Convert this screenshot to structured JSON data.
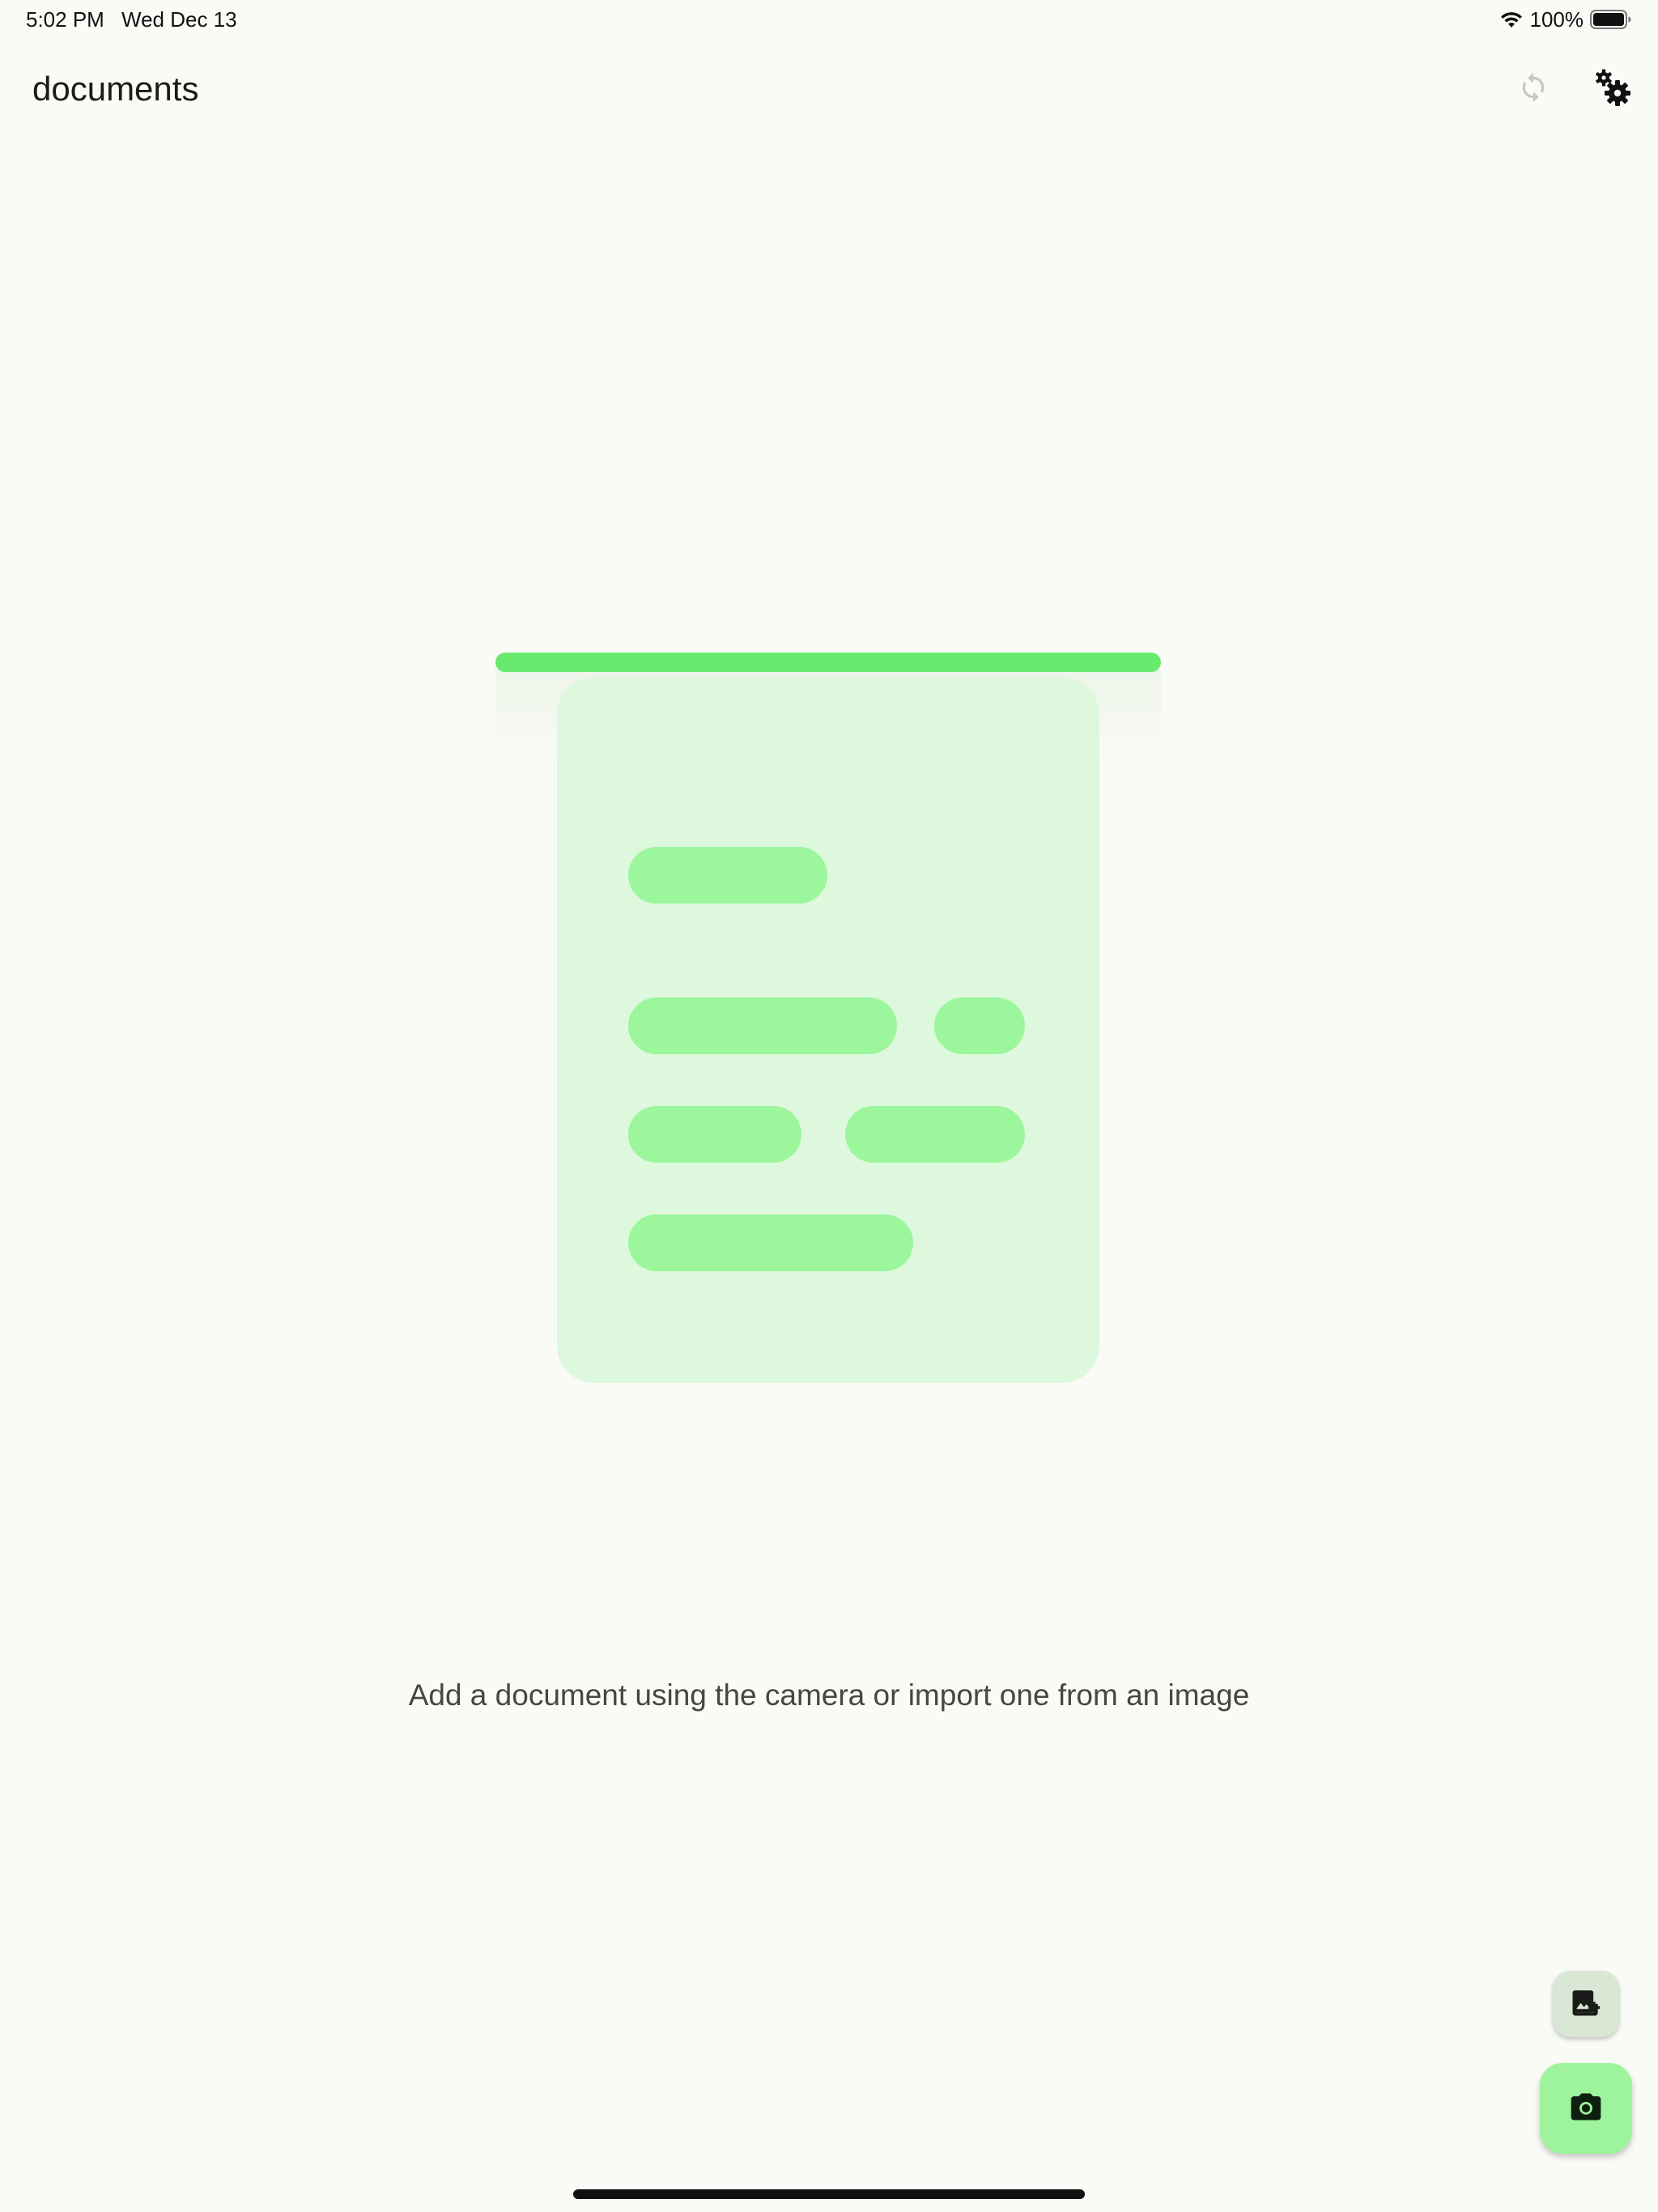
{
  "status_bar": {
    "time": "5:02 PM",
    "date": "Wed Dec 13",
    "battery_percent": "100%",
    "battery_level": 1.0,
    "icons": [
      "wifi-icon",
      "battery-icon"
    ]
  },
  "app_bar": {
    "title": "documents",
    "actions": [
      "sync-icon",
      "settings-gears-icon"
    ]
  },
  "empty_state": {
    "message": "Add a document using the camera or import one from an image"
  },
  "fabs": {
    "import_icon": "add-photo-icon",
    "camera_icon": "camera-icon"
  },
  "colors": {
    "background": "#fafbf6",
    "scan_line": "#69ea6f",
    "document_card": "#ddf8dd",
    "document_lines": "#9bf69c",
    "fab_import": "#d9e7d5",
    "fab_camera": "#9df49d",
    "sync_icon_disabled": "#c5c9c0"
  }
}
